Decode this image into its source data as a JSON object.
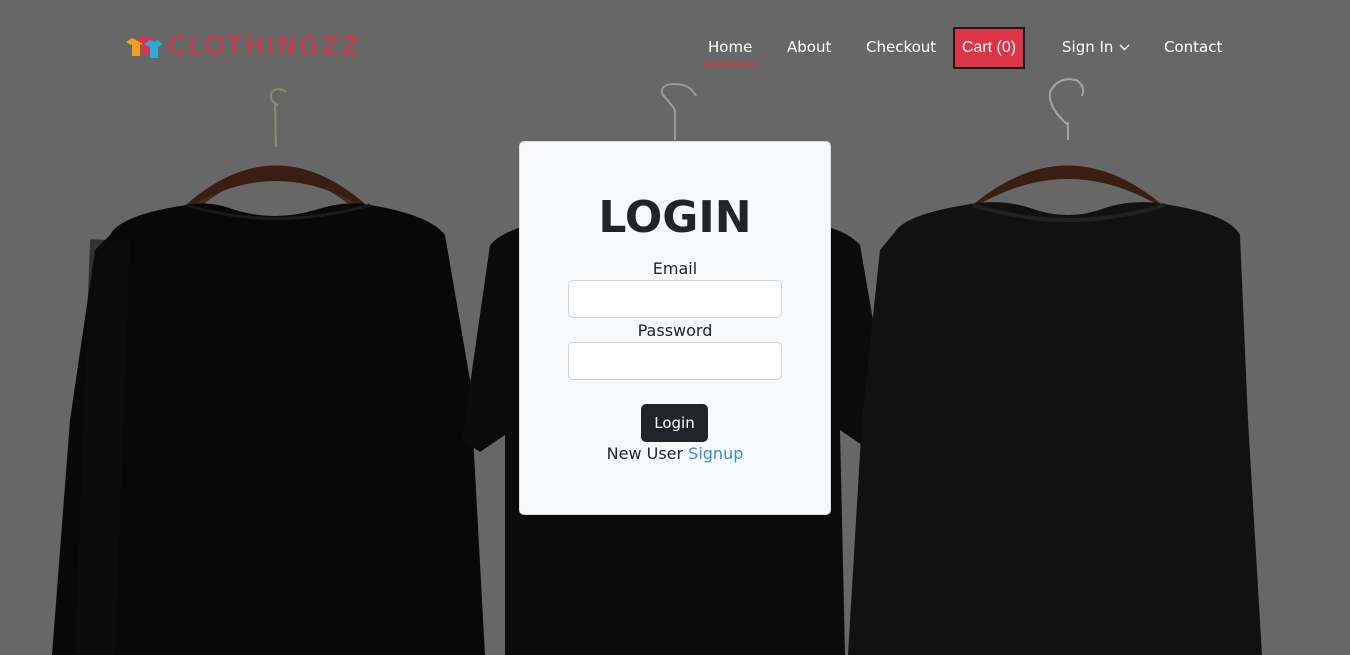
{
  "brand": {
    "name": "CLOTHINGZZ",
    "icon": "shirts-logo-icon",
    "color": "#e0314b"
  },
  "nav": {
    "home": "Home",
    "about": "About",
    "checkout": "Checkout",
    "cart": "Cart (0)",
    "sign_in": "Sign In",
    "contact": "Contact",
    "active_item": "Home",
    "accent_color": "#e0314b",
    "cart_color": "#dc3545"
  },
  "login": {
    "title": "LOGIN",
    "email_label": "Email",
    "email_value": "",
    "password_label": "Password",
    "password_value": "",
    "submit_label": "Login",
    "new_user_text": "New User",
    "signup_link": "Signup"
  },
  "background": {
    "scene": "black-shirts-on-hangers"
  }
}
